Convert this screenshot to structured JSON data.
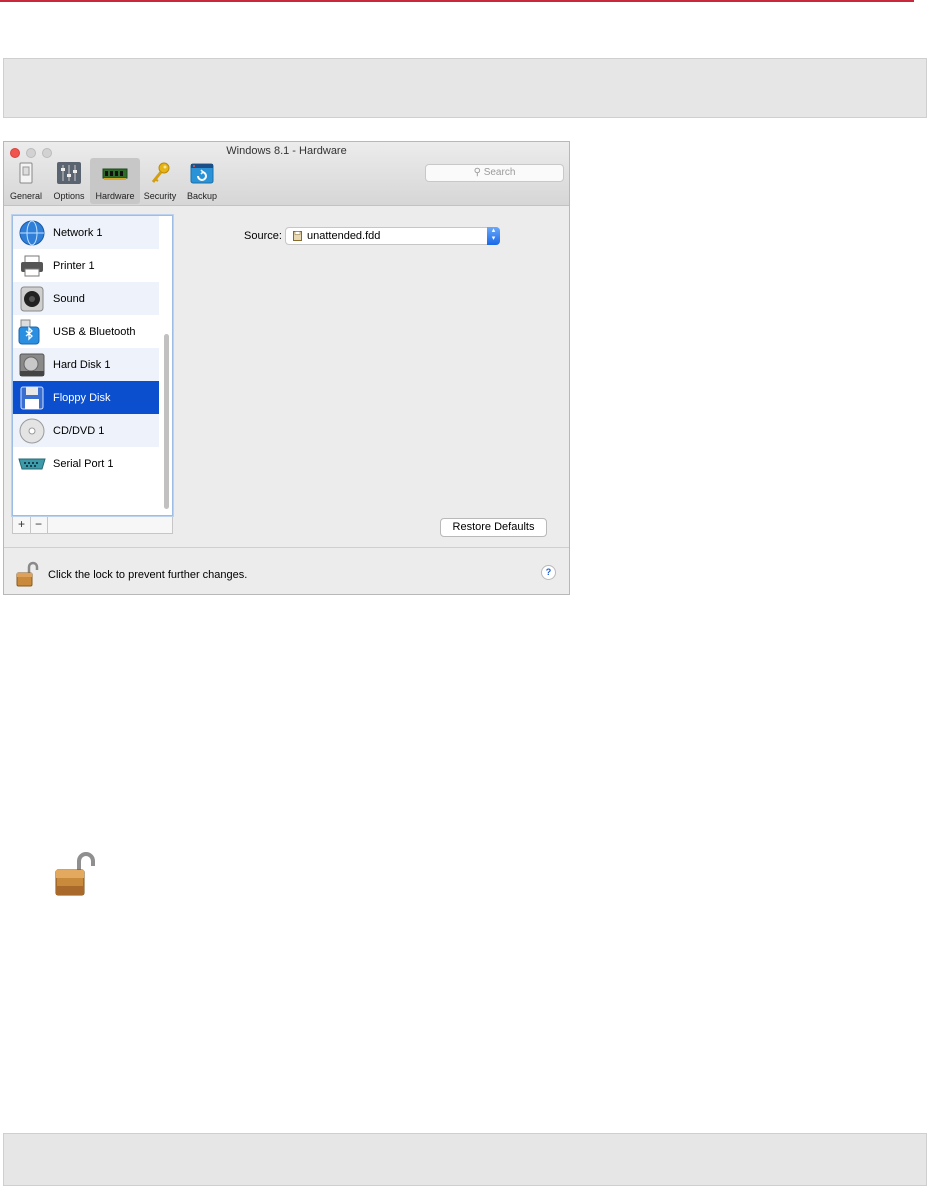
{
  "window": {
    "title": "Windows 8.1 - Hardware"
  },
  "toolbar": {
    "items": [
      {
        "label": "General",
        "icon": "switch-icon"
      },
      {
        "label": "Options",
        "icon": "sliders-icon"
      },
      {
        "label": "Hardware",
        "icon": "memory-chip-icon",
        "selected": true
      },
      {
        "label": "Security",
        "icon": "key-icon"
      },
      {
        "label": "Backup",
        "icon": "backup-icon"
      }
    ]
  },
  "search": {
    "placeholder": "Search"
  },
  "devices": [
    {
      "label": "Network 1",
      "icon": "globe-icon"
    },
    {
      "label": "Printer 1",
      "icon": "printer-icon"
    },
    {
      "label": "Sound",
      "icon": "speaker-icon"
    },
    {
      "label": "USB & Bluetooth",
      "icon": "usb-bluetooth-icon"
    },
    {
      "label": "Hard Disk 1",
      "icon": "hard-disk-icon"
    },
    {
      "label": "Floppy Disk",
      "icon": "floppy-disk-icon",
      "selected": true
    },
    {
      "label": "CD/DVD 1",
      "icon": "cd-dvd-icon"
    },
    {
      "label": "Serial Port 1",
      "icon": "serial-port-icon"
    }
  ],
  "list_buttons": {
    "add": "+",
    "remove": "−"
  },
  "source": {
    "label": "Source:",
    "value": "unattended.fdd"
  },
  "restore_label": "Restore Defaults",
  "lock": {
    "text": "Click the lock to prevent further changes."
  },
  "help_label": "?",
  "colors": {
    "accent": "#c8283b",
    "selection": "#0b4fcf"
  }
}
